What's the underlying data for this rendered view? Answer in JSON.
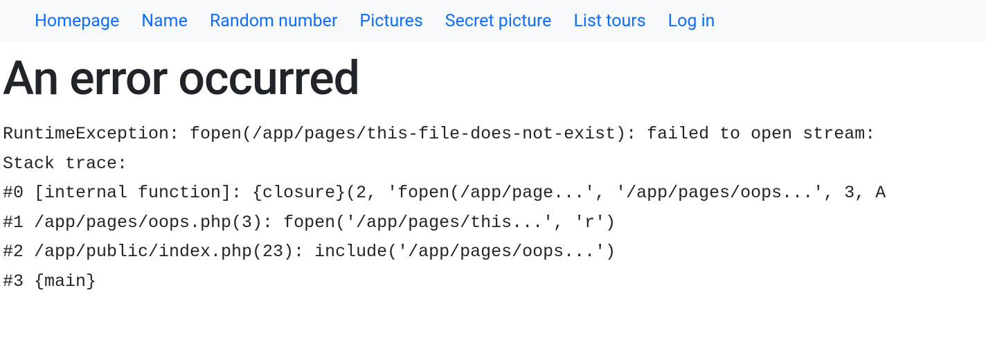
{
  "nav": {
    "items": [
      {
        "label": "Homepage"
      },
      {
        "label": "Name"
      },
      {
        "label": "Random number"
      },
      {
        "label": "Pictures"
      },
      {
        "label": "Secret picture"
      },
      {
        "label": "List tours"
      },
      {
        "label": "Log in"
      }
    ]
  },
  "page": {
    "title": "An error occurred"
  },
  "error": {
    "trace": "RuntimeException: fopen(/app/pages/this-file-does-not-exist): failed to open stream: \nStack trace:\n#0 [internal function]: {closure}(2, 'fopen(/app/page...', '/app/pages/oops...', 3, A\n#1 /app/pages/oops.php(3): fopen('/app/pages/this...', 'r')\n#2 /app/public/index.php(23): include('/app/pages/oops...')\n#3 {main}"
  }
}
